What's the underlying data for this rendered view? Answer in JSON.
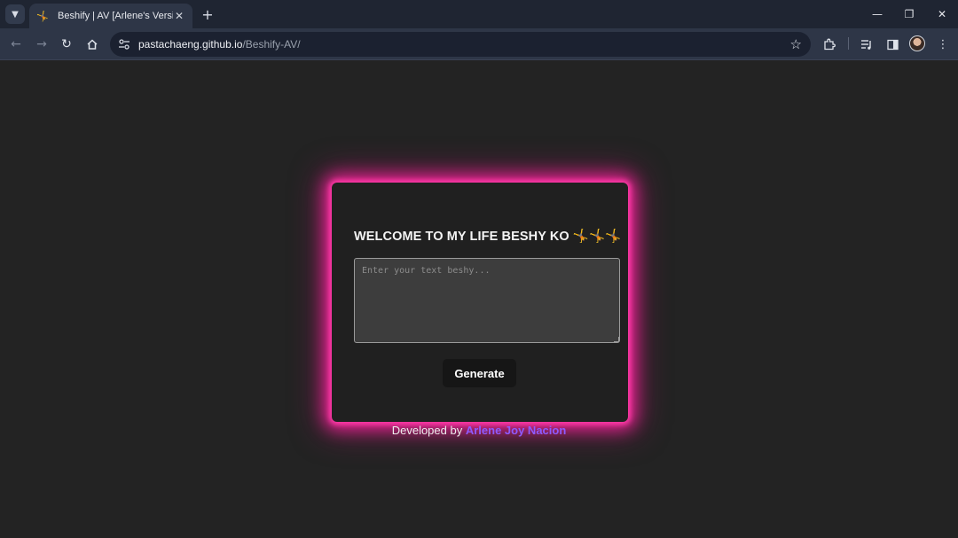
{
  "browser": {
    "tab": {
      "favicon": "🤸",
      "title": "Beshify | AV [Arlene's Version]",
      "close": "✕"
    },
    "new_tab": "+",
    "url_host": "pastachaeng.github.io",
    "url_path": "/Beshify-AV/",
    "window_controls": {
      "minimize": "—",
      "restore": "❐",
      "close": "✕"
    },
    "icons": {
      "tab_search": "chevron-down-icon",
      "back": "back-arrow-icon",
      "forward": "forward-arrow-icon",
      "reload": "reload-icon",
      "home": "home-icon",
      "site_info": "site-settings-icon",
      "bookmark": "star-icon",
      "extensions": "puzzle-icon",
      "media": "media-controls-icon",
      "side_panel": "side-panel-icon",
      "profile": "avatar",
      "menu": "kebab-menu-icon"
    }
  },
  "page": {
    "heading": "WELCOME TO MY LIFE BESHY KO 🤸🤸🤸",
    "input_placeholder": "Enter your text beshy...",
    "generate_label": "Generate",
    "footer_prefix": "Developed by ",
    "footer_author": "Arlene Joy Nacion"
  },
  "colors": {
    "page_bg": "#232323",
    "card_bg": "#202020",
    "glow": "#e0268f",
    "author_link": "#8f5bff"
  }
}
